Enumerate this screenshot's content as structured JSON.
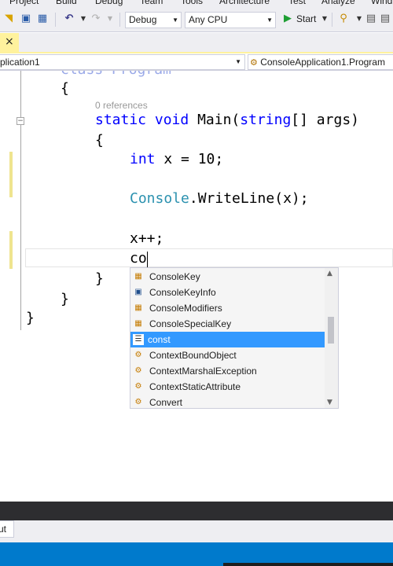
{
  "menubar": {
    "items": [
      "Project",
      "Build",
      "Debug",
      "Team",
      "Tools",
      "Architecture",
      "Test",
      "Analyze",
      "Wind"
    ]
  },
  "toolbar": {
    "configuration": "Debug",
    "platform": "Any CPU",
    "start_label": "Start",
    "icons": [
      "open-icon",
      "save-icon",
      "save-all-icon",
      "undo-icon",
      "redo-icon",
      "start-icon",
      "find-icon"
    ]
  },
  "tabstrip": {
    "close_glyph": "×",
    "accent_color": "#fff29d"
  },
  "navbar": {
    "project": "plication1",
    "class_path": "ConsoleApplication1.Program"
  },
  "editor": {
    "lines": {
      "class_decl": "class Program",
      "open_brace_class": "{",
      "codelens": "0 references",
      "main_static": "static",
      "main_void": "void",
      "main_name": " Main(",
      "main_string": "string",
      "main_rest": "[] args)",
      "open_brace_main": "{",
      "int_kw": "int",
      "int_rest": " x = 10;",
      "console_type": "Console",
      "console_rest": ".WriteLine(x);",
      "increment": "x++;",
      "typed": "co",
      "close_brace_main": "}",
      "close_brace_class": "}",
      "close_brace_ns": "}"
    }
  },
  "completion": {
    "items": [
      {
        "label": "ConsoleKey",
        "icon": "enum-icon",
        "selected": false
      },
      {
        "label": "ConsoleKeyInfo",
        "icon": "struct-icon",
        "selected": false
      },
      {
        "label": "ConsoleModifiers",
        "icon": "enum-icon",
        "selected": false
      },
      {
        "label": "ConsoleSpecialKey",
        "icon": "enum-icon",
        "selected": false
      },
      {
        "label": "const",
        "icon": "snippet-icon",
        "selected": true
      },
      {
        "label": "ContextBoundObject",
        "icon": "class-icon",
        "selected": false
      },
      {
        "label": "ContextMarshalException",
        "icon": "class-icon",
        "selected": false
      },
      {
        "label": "ContextStaticAttribute",
        "icon": "class-icon",
        "selected": false
      },
      {
        "label": "Convert",
        "icon": "class-icon",
        "selected": false
      }
    ]
  },
  "bottom": {
    "output_tab": "ut"
  },
  "colors": {
    "keyword": "#0000ff",
    "type": "#2b91af",
    "selection": "#3399ff",
    "statusbar": "#007acc"
  }
}
